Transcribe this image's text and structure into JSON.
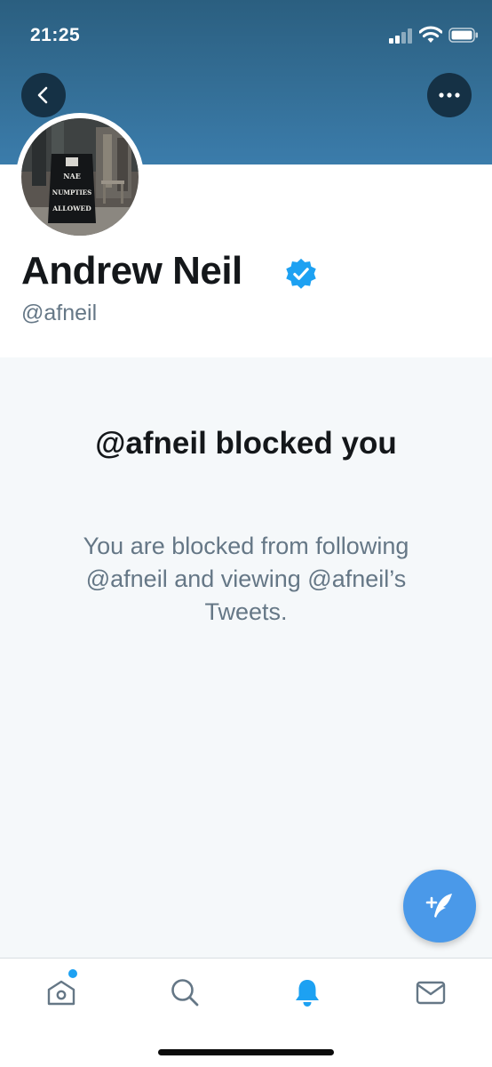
{
  "status_bar": {
    "time": "21:25",
    "icons": [
      "cellular-signal-icon",
      "wifi-icon",
      "battery-icon"
    ]
  },
  "header": {
    "back_icon": "chevron-left-icon",
    "more_icon": "more-horizontal-icon",
    "banner_color": "#346f97"
  },
  "profile": {
    "display_name": "Andrew Neil",
    "handle": "@afneil",
    "verified": true,
    "avatar_sign_text": [
      "NAE",
      "NUMPTIES",
      "ALLOWED"
    ]
  },
  "blocked": {
    "title": "@afneil blocked you",
    "message": "You are blocked from following @afneil and viewing @afneil’s Tweets."
  },
  "compose_button": {
    "icon": "compose-tweet-icon",
    "color": "#4a99e9"
  },
  "tab_bar": {
    "tabs": [
      {
        "name": "home",
        "icon": "home-icon",
        "has_badge": true
      },
      {
        "name": "search",
        "icon": "search-icon"
      },
      {
        "name": "notifications",
        "icon": "bell-icon",
        "active": true
      },
      {
        "name": "messages",
        "icon": "mail-icon"
      }
    ],
    "accent_color": "#1da1f2"
  }
}
